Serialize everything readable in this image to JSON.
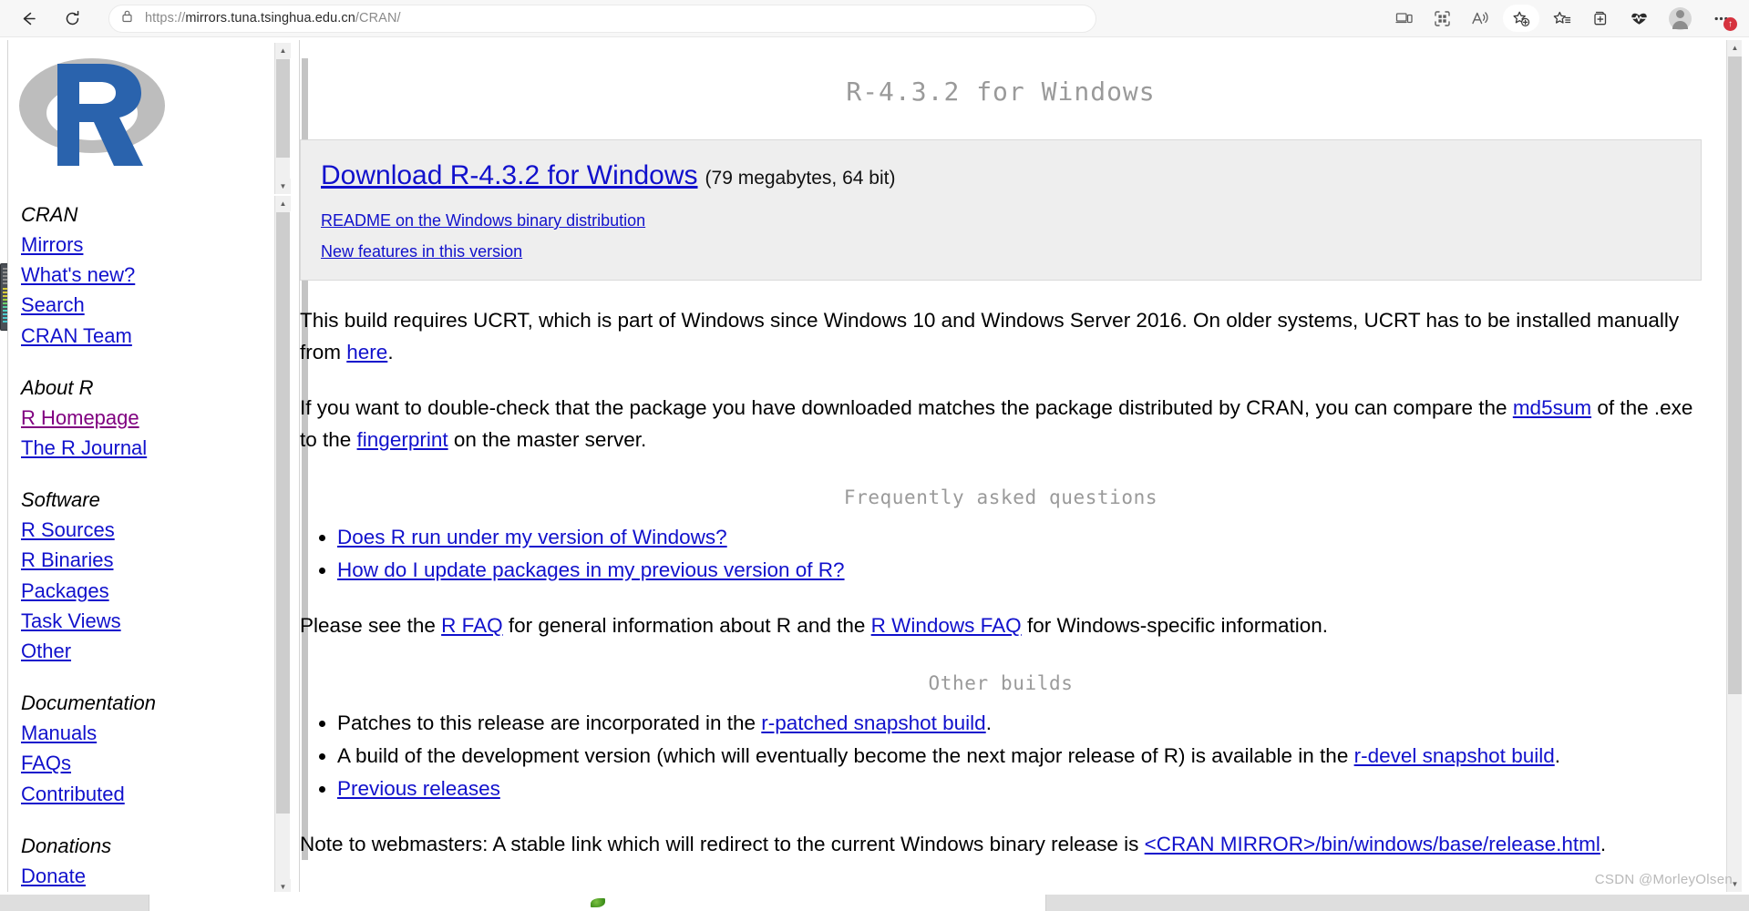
{
  "browser": {
    "back_icon": "back-arrow-icon",
    "refresh_icon": "refresh-icon",
    "lock_icon": "lock-icon",
    "url_scheme": "https://",
    "url_host": "mirrors.tuna.tsinghua.edu.cn",
    "url_path": "/CRAN/",
    "url_full": "https://mirrors.tuna.tsinghua.edu.cn/CRAN/",
    "actions": [
      {
        "name": "split-screen-icon",
        "label": "Split screen"
      },
      {
        "name": "qr-code-icon",
        "label": "QR code"
      },
      {
        "name": "read-aloud-icon",
        "label": "Read aloud"
      },
      {
        "name": "add-favorite-icon",
        "label": "Add this page to favorites"
      },
      {
        "name": "favorites-list-icon",
        "label": "Favorites"
      },
      {
        "name": "collections-icon",
        "label": "Collections"
      },
      {
        "name": "browser-essentials-icon",
        "label": "Browser essentials"
      },
      {
        "name": "profile-avatar",
        "label": "Profile"
      },
      {
        "name": "settings-more-icon",
        "label": "Settings and more"
      }
    ],
    "update_badge": "↑"
  },
  "sidebar": {
    "logo_alt": "R logo",
    "groups": [
      {
        "heading": "CRAN",
        "links": [
          {
            "label": "Mirrors",
            "visited": false
          },
          {
            "label": "What's new?",
            "visited": false
          },
          {
            "label": "Search",
            "visited": false
          },
          {
            "label": "CRAN Team",
            "visited": false
          }
        ]
      },
      {
        "heading": "About R",
        "links": [
          {
            "label": "R Homepage",
            "visited": true
          },
          {
            "label": "The R Journal",
            "visited": false
          }
        ]
      },
      {
        "heading": "Software",
        "links": [
          {
            "label": "R Sources",
            "visited": false
          },
          {
            "label": "R Binaries",
            "visited": false
          },
          {
            "label": "Packages",
            "visited": false
          },
          {
            "label": "Task Views",
            "visited": false
          },
          {
            "label": "Other",
            "visited": false
          }
        ]
      },
      {
        "heading": "Documentation",
        "links": [
          {
            "label": "Manuals",
            "visited": false
          },
          {
            "label": "FAQs",
            "visited": false
          },
          {
            "label": "Contributed",
            "visited": false
          }
        ]
      },
      {
        "heading": "Donations",
        "links": [
          {
            "label": "Donate",
            "visited": false
          }
        ]
      }
    ]
  },
  "main": {
    "title": "R-4.3.2 for Windows",
    "download": {
      "main_link": "Download R-4.3.2 for Windows",
      "size_note": "(79 megabytes, 64 bit)",
      "readme_link": "README on the Windows binary distribution",
      "new_features_link": "New features in this version"
    },
    "ucrt_paragraph": {
      "before": "This build requires UCRT, which is part of Windows since Windows 10 and Windows Server 2016. On older systems, UCRT has to be installed manually from ",
      "link": "here",
      "after": "."
    },
    "md5_paragraph": {
      "before": "If you want to double-check that the package you have downloaded matches the package distributed by CRAN, you can compare the ",
      "link1": "md5sum",
      "middle": " of the .exe to the ",
      "link2": "fingerprint",
      "after": " on the master server."
    },
    "faq_heading": "Frequently asked questions",
    "faq_items": [
      "Does R run under my version of Windows?",
      "How do I update packages in my previous version of R?"
    ],
    "faq_see_also": {
      "before": "Please see the ",
      "link1": "R FAQ",
      "middle": " for general information about R and the ",
      "link2": "R Windows FAQ",
      "after": " for Windows-specific information."
    },
    "other_builds_heading": "Other builds",
    "other_builds": {
      "item1_before": "Patches to this release are incorporated in the ",
      "item1_link": "r-patched snapshot build",
      "item1_after": ".",
      "item2_before": "A build of the development version (which will eventually become the next major release of R) is available in the ",
      "item2_link": "r-devel snapshot build",
      "item2_after": ".",
      "item3_link": "Previous releases"
    },
    "webmaster_note": {
      "before": "Note to webmasters: A stable link which will redirect to the current Windows binary release is ",
      "link": "<CRAN MIRROR>/bin/windows/base/release.html",
      "after": "."
    }
  },
  "watermark": "CSDN @MorleyOlsen",
  "colors": {
    "link": "#1111cc",
    "visited_link": "#800080",
    "heading_grey": "#9a9a9a",
    "download_box_bg": "#eeeeee",
    "badge_red": "#d6333f",
    "r_logo_blue": "#2a63ad",
    "r_logo_grey": "#bdbdbd"
  }
}
